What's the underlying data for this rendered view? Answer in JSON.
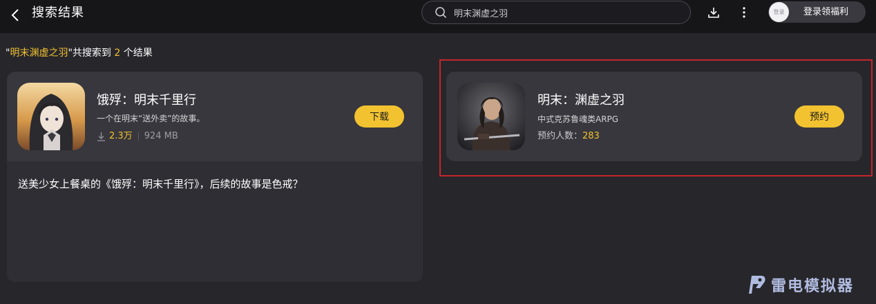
{
  "header": {
    "title": "搜索结果",
    "search_value": "明末渊虚之羽",
    "login_avatar_text": "登录",
    "login_label": "登录领福利"
  },
  "summary": {
    "quote_open": "\"",
    "query": "明末渊虚之羽",
    "middle": "\"共搜索到 ",
    "count": "2",
    "suffix": " 个结果"
  },
  "results": [
    {
      "name": "饿殍：明末千里行",
      "desc": "一个在明末“送外卖”的故事。",
      "downloads": "2.3万",
      "size": "924 MB",
      "button": "下载",
      "article": "送美少女上餐桌的《饿殍：明末千里行》，后续的故事是色戒？"
    },
    {
      "name": "明末：渊虚之羽",
      "desc": "中式克苏鲁魂类ARPG",
      "reservations_label": "预约人数：",
      "reservations": "283",
      "button": "预约"
    }
  ],
  "watermark": "雷电模拟器",
  "colors": {
    "accent": "#f2c230",
    "highlight_border": "#c4262a",
    "background": "#27262b",
    "card": "#38373d"
  },
  "icons": [
    "back-arrow-icon",
    "search-icon",
    "download-icon",
    "more-vertical-icon",
    "download-count-icon",
    "leidian-logo-icon"
  ]
}
